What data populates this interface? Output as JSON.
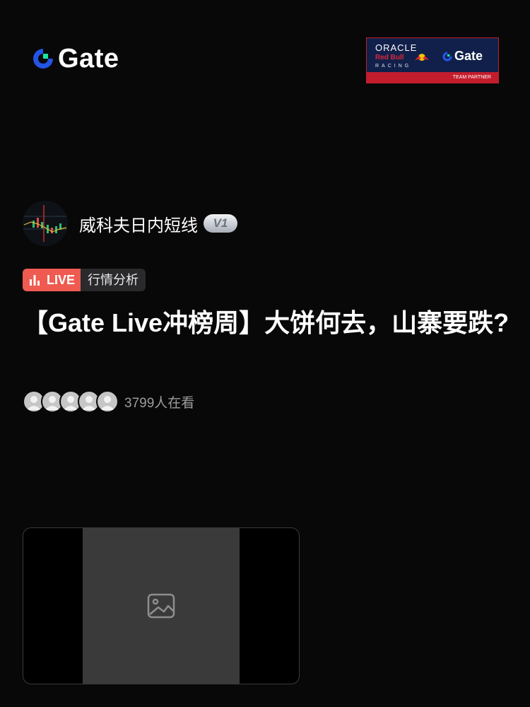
{
  "header": {
    "logo_text": "Gate",
    "partner": {
      "line1": "ORACLE",
      "line2": "Red Bull",
      "line3": "RACING",
      "brand": "Gate",
      "bar_text": "TEAM PARTNER"
    }
  },
  "author": {
    "name": "威科夫日内短线",
    "badge": "V1"
  },
  "tags": {
    "live": "LIVE",
    "category": "行情分析"
  },
  "title": "【Gate Live冲榜周】大饼何去，山寨要跌?",
  "viewers": {
    "count_text": "3799人在看"
  },
  "colors": {
    "background": "#080808",
    "brand_blue": "#2354e6",
    "brand_green": "#18e3a2",
    "live_red": "#ef5b50",
    "partner_navy": "#11204a",
    "partner_red": "#c31d2d"
  },
  "icons": {
    "logo": "gate-logo-icon",
    "live": "bar-chart-icon",
    "viewer": "avatar-placeholder-icon",
    "video": "image-placeholder-icon"
  }
}
